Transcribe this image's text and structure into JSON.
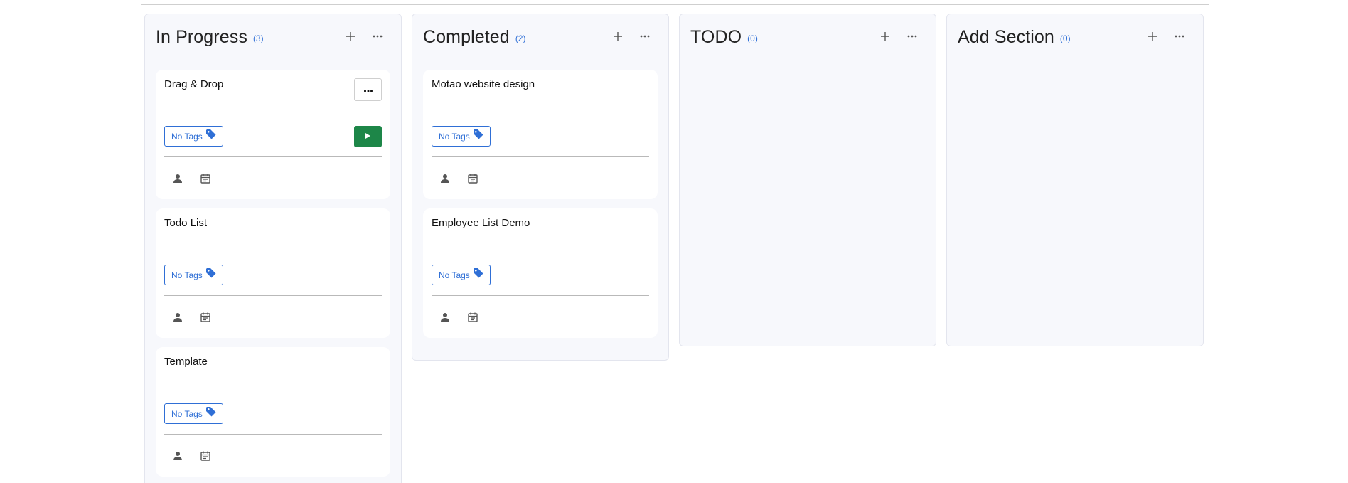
{
  "columns": [
    {
      "title": "In Progress",
      "count": "(3)",
      "cards": [
        {
          "title": "Drag & Drop",
          "tag": "No Tags",
          "show_menu": true,
          "show_play": true
        },
        {
          "title": "Todo List",
          "tag": "No Tags"
        },
        {
          "title": "Template",
          "tag": "No Tags"
        }
      ]
    },
    {
      "title": "Completed",
      "count": "(2)",
      "cards": [
        {
          "title": "Motao website design",
          "tag": "No Tags"
        },
        {
          "title": "Employee List Demo",
          "tag": "No Tags"
        }
      ]
    },
    {
      "title": "TODO",
      "count": "(0)",
      "cards": []
    },
    {
      "title": "Add Section",
      "count": "(0)",
      "cards": []
    }
  ],
  "icons": {
    "add": "plus-icon",
    "more": "ellipsis-icon",
    "tag": "tag-icon",
    "play": "play-icon",
    "assignee": "person-icon",
    "due_date": "calendar-icon"
  },
  "colors": {
    "accent": "#2f6fd6",
    "play_button": "#1d8648",
    "column_bg": "#f7f8fc",
    "card_bg": "#ffffff"
  }
}
